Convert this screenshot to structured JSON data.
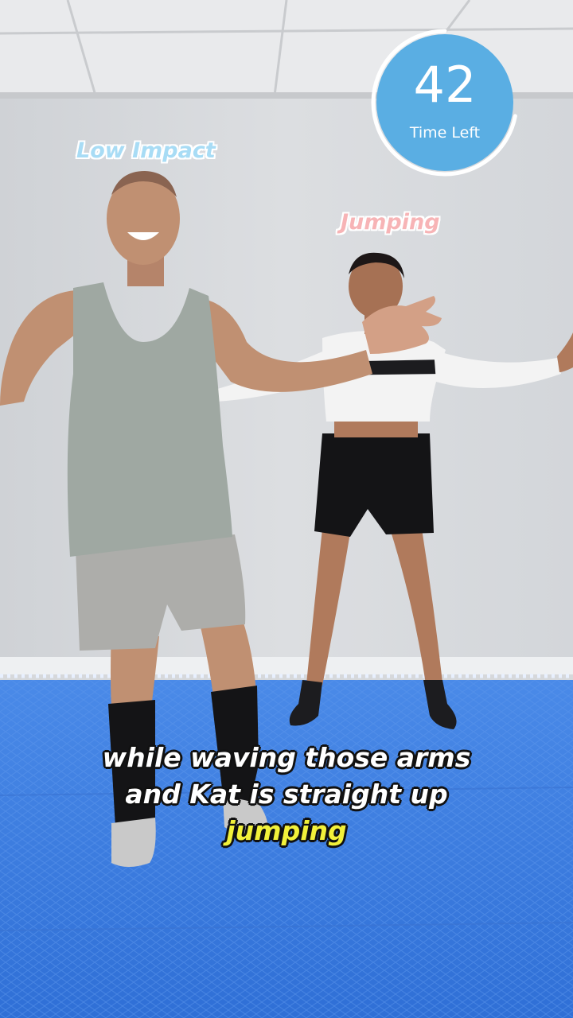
{
  "timer": {
    "value": "42",
    "caption": "Time Left",
    "progress_fraction": 0.72,
    "color": "#5aaee3"
  },
  "labels": {
    "left": "Low Impact",
    "right": "Jumping"
  },
  "subtitle": {
    "line1": "while waving those arms",
    "line2": "and Kat is straight up",
    "highlight": "jumping"
  },
  "colors": {
    "floor": "#3d7fe0",
    "wall": "#d6d8db",
    "highlight": "#f2f13a"
  }
}
